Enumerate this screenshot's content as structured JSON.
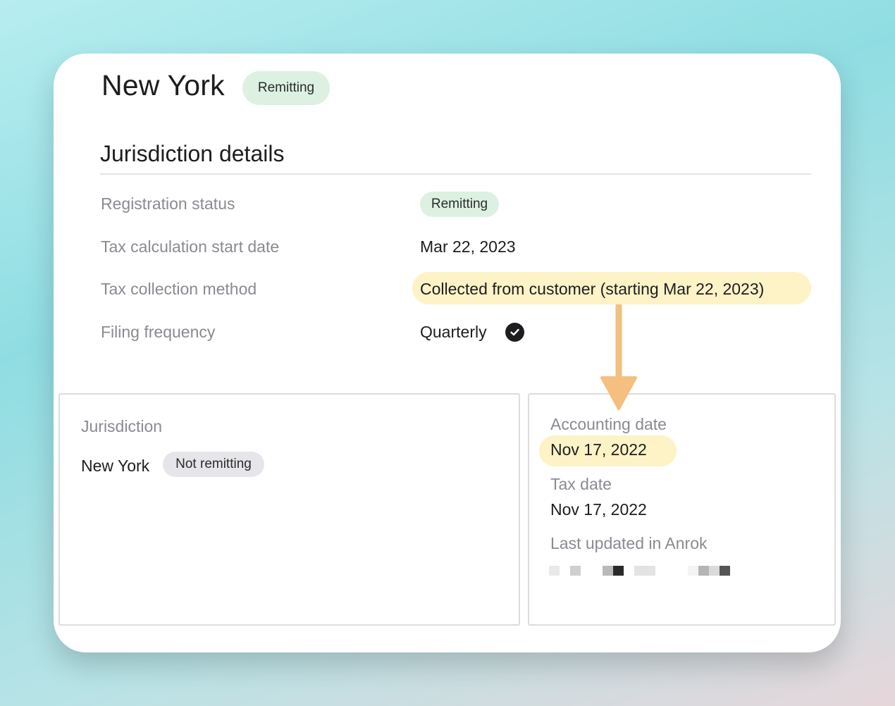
{
  "header": {
    "title": "New York",
    "status_badge": "Remitting"
  },
  "jurisdiction_details": {
    "section_title": "Jurisdiction details",
    "rows": [
      {
        "label": "Registration status",
        "value": "Remitting"
      },
      {
        "label": "Tax calculation start date",
        "value": "Mar 22, 2023"
      },
      {
        "label": "Tax collection method",
        "value": "Collected from customer (starting Mar 22, 2023)"
      },
      {
        "label": "Filing frequency",
        "value": "Quarterly"
      }
    ]
  },
  "jurisdiction_panel": {
    "label": "Jurisdiction",
    "name": "New York",
    "status_badge": "Not remitting"
  },
  "dates_panel": {
    "accounting_date_label": "Accounting date",
    "accounting_date": "Nov 17, 2022",
    "tax_date_label": "Tax date",
    "tax_date": "Nov 17, 2022",
    "last_updated_label": "Last updated in Anrok"
  },
  "colors": {
    "highlight": "#fdf3c6",
    "remitting_badge": "#dcf1e2",
    "not_remitting_badge": "#e6e6ea",
    "arrow": "#f5bf7f"
  },
  "icons": {
    "filing_frequency_check": "check-circle-icon",
    "annotation_arrow": "arrow-down-icon"
  }
}
